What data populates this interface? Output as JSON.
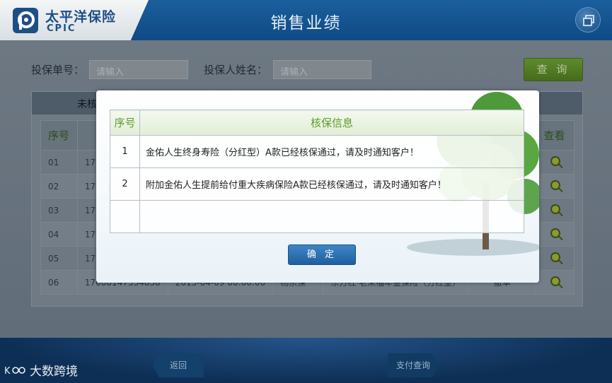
{
  "header": {
    "brand_cn": "太平洋保险",
    "brand_en": "CPIC",
    "title": "销售业绩"
  },
  "search": {
    "policy_no_label": "投保单号：",
    "policy_no_placeholder": "请输入",
    "holder_name_label": "投保人姓名：",
    "holder_name_placeholder": "请输入",
    "query_button": "查 询"
  },
  "panel": {
    "tab_label": "未核"
  },
  "background_table": {
    "headers": [
      "序号",
      "",
      "",
      "",
      "",
      "",
      "查看"
    ],
    "rows": [
      {
        "idx": "01",
        "policy": "17"
      },
      {
        "idx": "02",
        "policy": "17"
      },
      {
        "idx": "03",
        "policy": "17"
      },
      {
        "idx": "04",
        "policy": "17"
      },
      {
        "idx": "05",
        "policy": "17"
      },
      {
        "idx": "06",
        "policy": "17008147334838",
        "date": "2013-04-09 00:00:00",
        "holder": "杨宗保",
        "product": "东方红·老来福年金保险（分红型）",
        "status": "撤单"
      }
    ]
  },
  "modal": {
    "col_index": "序号",
    "col_info": "核保信息",
    "rows": [
      {
        "idx": "1",
        "info": "金佑人生终身寿险（分红型）A款已经核保通过，请及时通知客户！"
      },
      {
        "idx": "2",
        "info": "附加金佑人生提前给付重大疾病保险A款已经核保通过，请及时通知客户！"
      },
      {
        "idx": "",
        "info": ""
      }
    ],
    "confirm_button": "确 定"
  },
  "footer": {
    "back_button": "返回",
    "pay_query_button": "支付查询"
  },
  "watermark": "大数跨境",
  "colors": {
    "header_blue": "#1a5f9c",
    "brand_blue": "#1d4f86",
    "accent_green": "#5d9a2a",
    "confirm_blue": "#2a6fb0"
  }
}
